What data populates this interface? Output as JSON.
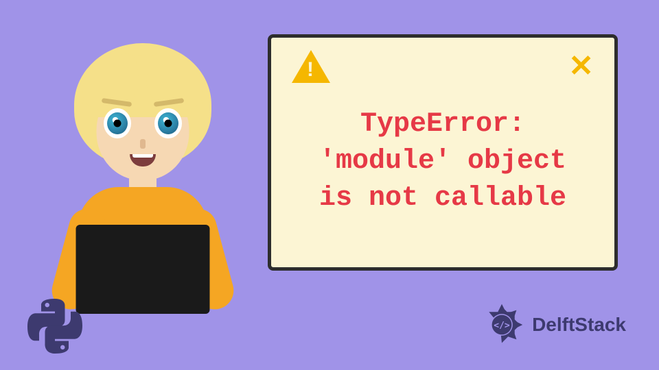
{
  "dialog": {
    "error_lines": "TypeError:\n'module' object\nis not callable"
  },
  "brand": {
    "name": "DelftStack"
  },
  "icons": {
    "warning": "warning-triangle-icon",
    "close": "close-icon",
    "python": "python-icon",
    "delft_emblem": "delft-emblem-icon"
  }
}
